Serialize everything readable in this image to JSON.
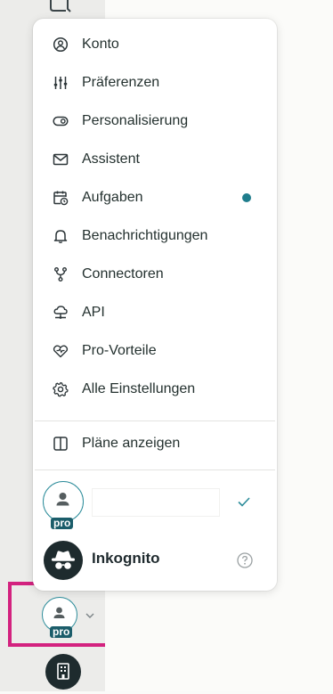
{
  "menu": {
    "items": [
      {
        "label": "Konto",
        "icon": "user-circle-icon"
      },
      {
        "label": "Präferenzen",
        "icon": "sliders-icon"
      },
      {
        "label": "Personalisierung",
        "icon": "toggle-icon"
      },
      {
        "label": "Assistent",
        "icon": "mail-icon"
      },
      {
        "label": "Aufgaben",
        "icon": "calendar-clock-icon",
        "badge": "new-dot"
      },
      {
        "label": "Benachrichtigungen",
        "icon": "bell-icon"
      },
      {
        "label": "Connectoren",
        "icon": "branch-icon"
      },
      {
        "label": "API",
        "icon": "cloud-network-icon"
      },
      {
        "label": "Pro-Vorteile",
        "icon": "heart-icon"
      },
      {
        "label": "Alle Einstellungen",
        "icon": "gear-icon"
      }
    ],
    "plans_label": "Pläne anzeigen"
  },
  "account": {
    "badge": "pro",
    "name": "",
    "selected": true
  },
  "incognito": {
    "label": "Inkognito"
  },
  "bottom_avatar": {
    "badge": "pro"
  },
  "colors": {
    "accent": "#1f7d8c",
    "pro_badge": "#1b5d6a",
    "highlight": "#d3227f",
    "dark": "#1e2b2e"
  }
}
